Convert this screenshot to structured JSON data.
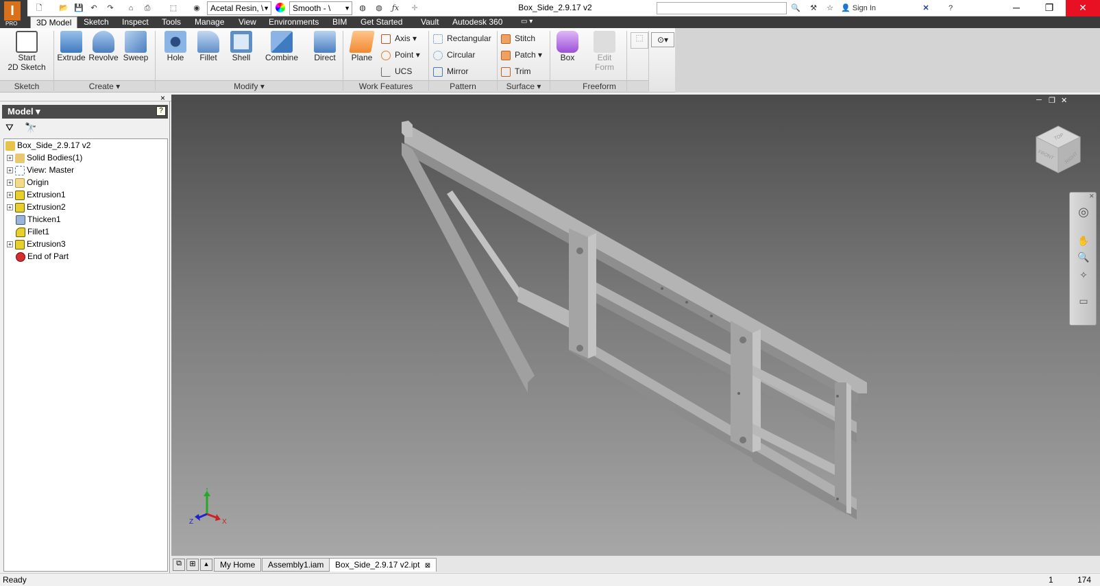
{
  "app": {
    "logo_text": "I",
    "edition": "PRO"
  },
  "quick_access": {
    "material": "Acetal Resin, \\",
    "appearance": "Smooth - \\",
    "fx": "ƒx"
  },
  "window": {
    "title": "Box_Side_2.9.17 v2",
    "sign_in": "Sign In",
    "minimize": "─",
    "restore": "❐",
    "close": "✕"
  },
  "tabs": [
    "3D Model",
    "Sketch",
    "Inspect",
    "Tools",
    "Manage",
    "View",
    "Environments",
    "BIM",
    "Get Started",
    "Vault",
    "Autodesk 360"
  ],
  "ribbon": {
    "sketch": {
      "label": "Sketch",
      "start": "Start",
      "start2": "2D Sketch"
    },
    "create": {
      "label": "Create",
      "extrude": "Extrude",
      "revolve": "Revolve",
      "sweep": "Sweep"
    },
    "modify": {
      "label": "Modify",
      "hole": "Hole",
      "fillet": "Fillet",
      "shell": "Shell",
      "combine": "Combine",
      "direct": "Direct"
    },
    "work_features": {
      "label": "Work Features",
      "plane": "Plane",
      "axis": "Axis",
      "point": "Point",
      "ucs": "UCS"
    },
    "pattern": {
      "label": "Pattern",
      "rectangular": "Rectangular",
      "circular": "Circular",
      "mirror": "Mirror"
    },
    "surface": {
      "label": "Surface",
      "stitch": "Stitch",
      "patch": "Patch",
      "trim": "Trim"
    },
    "freeform": {
      "label": "Freeform",
      "box": "Box",
      "edit": "Edit",
      "form": "Form"
    }
  },
  "browser": {
    "title": "Model",
    "close": "×",
    "help": "?",
    "nodes": [
      {
        "label": "Box_Side_2.9.17 v2",
        "color": "#e8c34a"
      },
      {
        "label": "Solid Bodies(1)",
        "color": "#e8c34a"
      },
      {
        "label": "View: Master",
        "color": "#4a78c8"
      },
      {
        "label": "Origin",
        "color": "#e8c870"
      },
      {
        "label": "Extrusion1",
        "color": "#e8d02a"
      },
      {
        "label": "Extrusion2",
        "color": "#e8d02a"
      },
      {
        "label": "Thicken1",
        "color": "#7a9ad0"
      },
      {
        "label": "Fillet1",
        "color": "#e8d02a"
      },
      {
        "label": "Extrusion3",
        "color": "#e8d02a"
      },
      {
        "label": "End of Part",
        "color": "#d03030"
      }
    ]
  },
  "viewcube": {
    "top": "TOP",
    "front": "FRONT",
    "right": "RIGHT"
  },
  "triad": {
    "x": "X",
    "y": "Y",
    "z": "Z"
  },
  "doc_tabs": [
    "My Home",
    "Assembly1.iam",
    "Box_Side_2.9.17 v2.ipt"
  ],
  "doc_tab_close": "⊠",
  "status": {
    "text": "Ready",
    "count1": "1",
    "count2": "174"
  },
  "viewport_controls": {
    "min": "─",
    "restore": "❐",
    "close": "✕"
  },
  "colors": {
    "accent": "#d9701c",
    "tab_bar": "#3b3b3b",
    "close_red": "#e81123",
    "part": "#a8a8a8"
  }
}
